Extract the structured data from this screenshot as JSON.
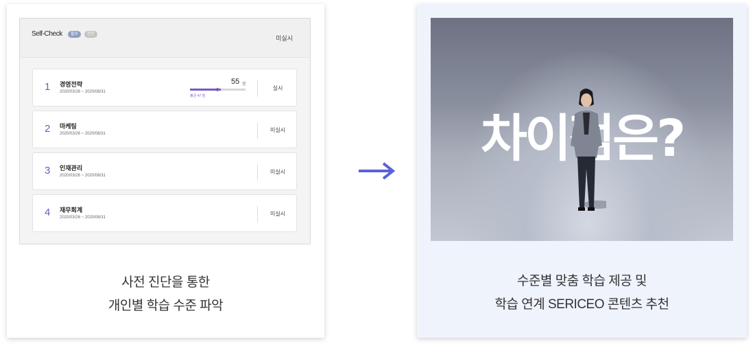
{
  "left_card": {
    "panel": {
      "title": "Self-Check",
      "badges": [
        "필수",
        "진단"
      ],
      "status": "미실시"
    },
    "items": [
      {
        "no": "1",
        "name": "경영전략",
        "date": "2020/03/26 ~ 2020/08/31",
        "status": "실시",
        "score": "55",
        "score_unit": "점",
        "avg_label": "평균 47 점",
        "progress_fraction": 0.55
      },
      {
        "no": "2",
        "name": "마케팅",
        "date": "2020/03/26 ~ 2020/08/31",
        "status": "미실시"
      },
      {
        "no": "3",
        "name": "인재관리",
        "date": "2020/03/26 ~ 2020/08/31",
        "status": "미실시"
      },
      {
        "no": "4",
        "name": "재무회계",
        "date": "2020/03/26 ~ 2020/08/31",
        "status": "미실시"
      }
    ],
    "caption": [
      "사전 진단을 통한",
      "개인별 학습 수준 파악"
    ]
  },
  "arrow_icon": "right-arrow-icon",
  "right_card": {
    "video": {
      "overlay_text": "차이점은?"
    },
    "caption": [
      "수준별 맞춤 학습 제공 및",
      "학습 연계 SERICEO 콘텐츠 추천"
    ]
  },
  "colors": {
    "accent": "#6a5bc4",
    "arrow": "#5a63d6",
    "right_card_bg": "#eff3fc"
  }
}
